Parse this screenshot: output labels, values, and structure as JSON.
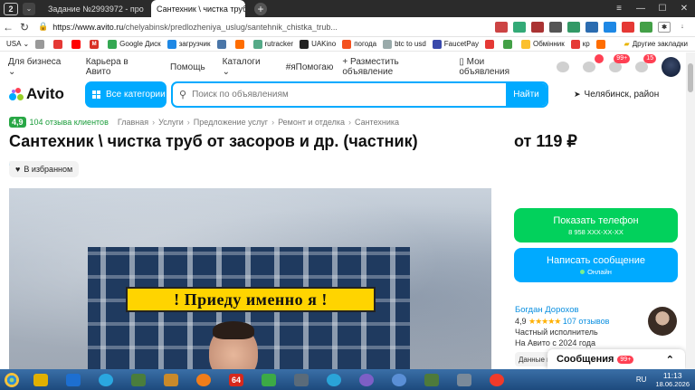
{
  "browser": {
    "tab_count": "2",
    "tabs": [
      {
        "label": "Задание №2993972 - про",
        "favicon": "$P"
      },
      {
        "label": "Сантехник \\ чистка труб",
        "favicon": "A"
      }
    ],
    "new_tab": "+",
    "url_host": "https://www.avito.ru",
    "url_path": "/chelyabinsk/predlozheniya_uslug/santehnik_chistka_trub...",
    "bookmarks": [
      "USA",
      "",
      "",
      "",
      "Google Диск",
      "загрузчик",
      "",
      "",
      "rutracker",
      "UAKino",
      "погода",
      "btc to usd",
      "FaucetPay",
      "",
      "",
      "",
      "Обмінник",
      "кр",
      "",
      ""
    ],
    "other_bookmarks": "Другие закладки"
  },
  "site_nav": {
    "left": [
      "Для бизнеса",
      "Карьера в Авито",
      "Помощь",
      "Каталоги",
      "#яПомогаю"
    ],
    "post_ad": "Разместить объявление",
    "my_ads": "Мои объявления",
    "badges": {
      "notifications": "",
      "messages": "99+",
      "cart": "15"
    }
  },
  "header": {
    "logo": "Avito",
    "categories_button": "Все категории",
    "search_placeholder": "Поиск по объявлениям",
    "search_button": "Найти",
    "city": "Челябинск, район"
  },
  "breadcrumbs": {
    "rating": "4,9",
    "reviews": "104 отзыва клиентов",
    "items": [
      "Главная",
      "Услуги",
      "Предложение услуг",
      "Ремонт и отделка",
      "Сантехника"
    ]
  },
  "listing": {
    "title": "Сантехник \\ чистка труб от засоров и др. (частник)",
    "price": "от 119 ₽",
    "favorite_button": "В избранном",
    "photo_banner": "! Приеду именно я !"
  },
  "actions": {
    "show_phone": "Показать телефон",
    "phone_masked": "8 958 XXX-XX-XX",
    "write_message": "Написать сообщение",
    "online": "Онлайн"
  },
  "seller": {
    "name": "Богдан Дорохов",
    "rating": "4,9",
    "stars": "★★★★★",
    "reviews": "107 отзывов",
    "type": "Частный исполнитель",
    "since": "На Авито с 2024 года",
    "chip": "Данные п"
  },
  "messages_panel": {
    "label": "Сообщения",
    "badge": "99+"
  },
  "taskbar": {
    "lang": "RU",
    "time": "11:13",
    "date": "18.06.2026"
  },
  "colors": {
    "accent": "#00aaff",
    "green": "#02d15c",
    "badge": "#ff4053"
  }
}
